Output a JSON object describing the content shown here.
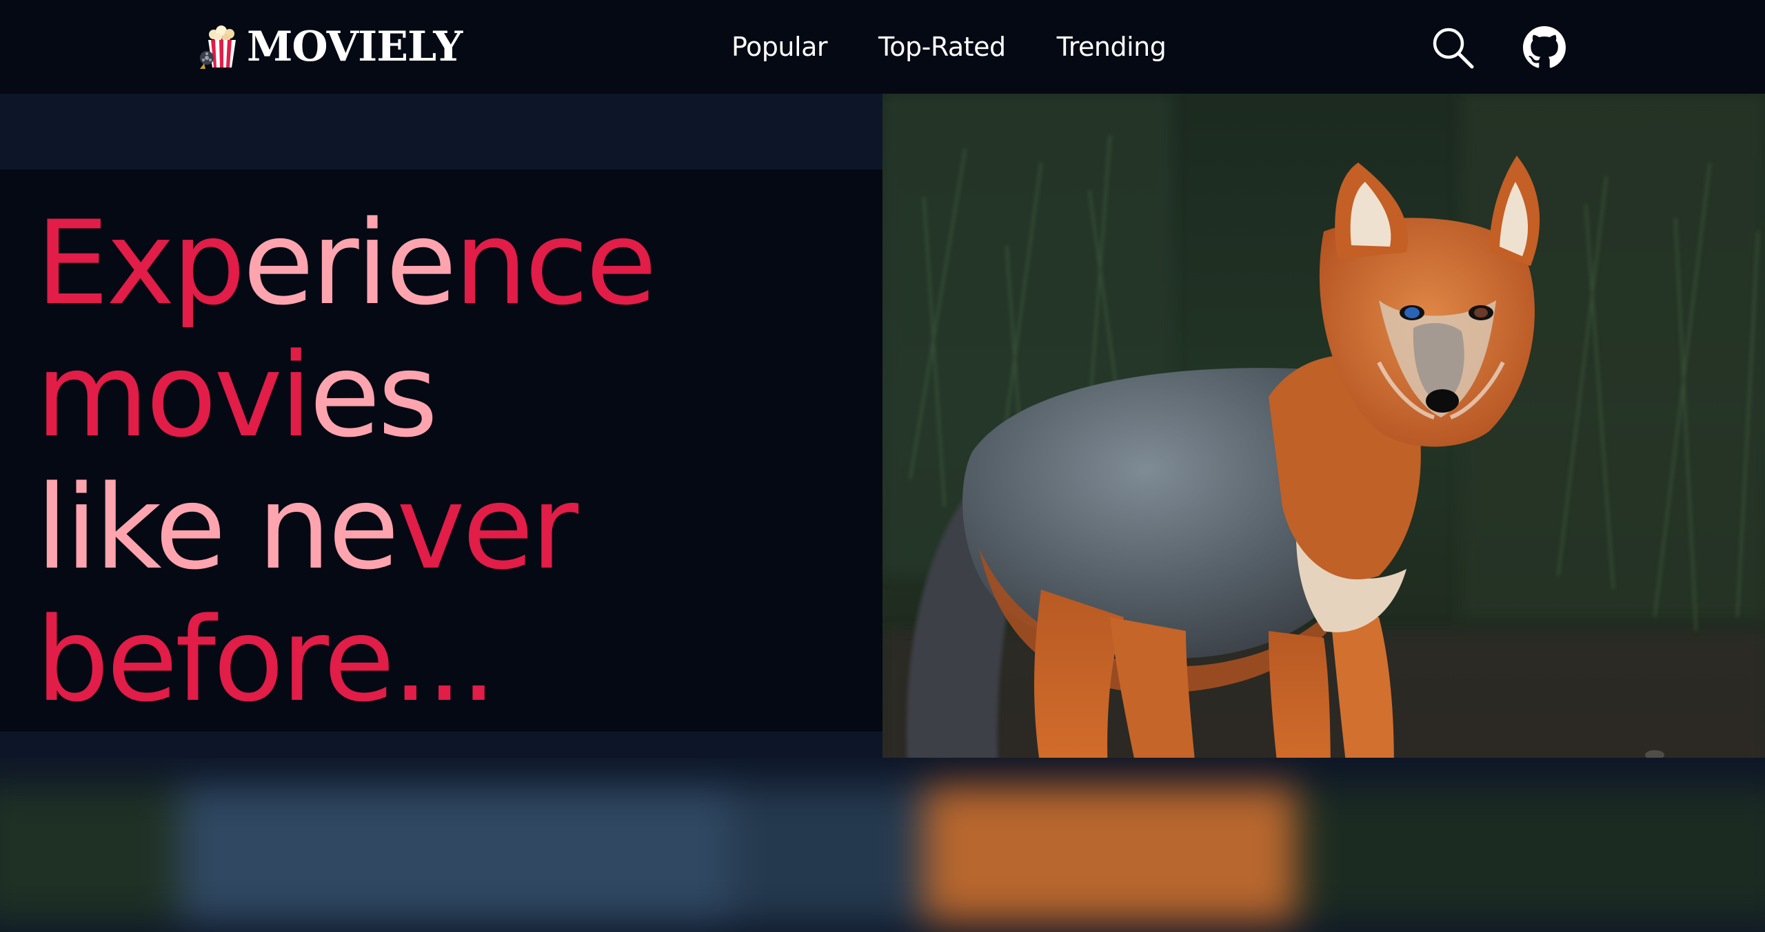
{
  "app": {
    "brand_name": "MOVIELY"
  },
  "nav": {
    "links": [
      {
        "label": "Popular"
      },
      {
        "label": "Top-Rated"
      },
      {
        "label": "Trending"
      }
    ],
    "search_icon": "search-icon",
    "github_icon": "github-icon"
  },
  "hero": {
    "title_lines": [
      [
        {
          "text": "Exp",
          "tone": "red"
        },
        {
          "text": "erie",
          "tone": "pink"
        },
        {
          "text": "nce",
          "tone": "red"
        }
      ],
      [
        {
          "text": "movi",
          "tone": "red"
        },
        {
          "text": "es",
          "tone": "pink"
        }
      ],
      [
        {
          "text": "like ne",
          "tone": "pink"
        },
        {
          "text": "ver",
          "tone": "red"
        }
      ],
      [
        {
          "text": "before...",
          "tone": "red"
        }
      ]
    ],
    "image_subject": "fox in tall grass"
  },
  "colors": {
    "nav_bg": "#050914",
    "page_bg": "#0d1628",
    "accent_red": "#e11d48",
    "accent_pink": "#fda4af",
    "text_white": "#ffffff"
  }
}
